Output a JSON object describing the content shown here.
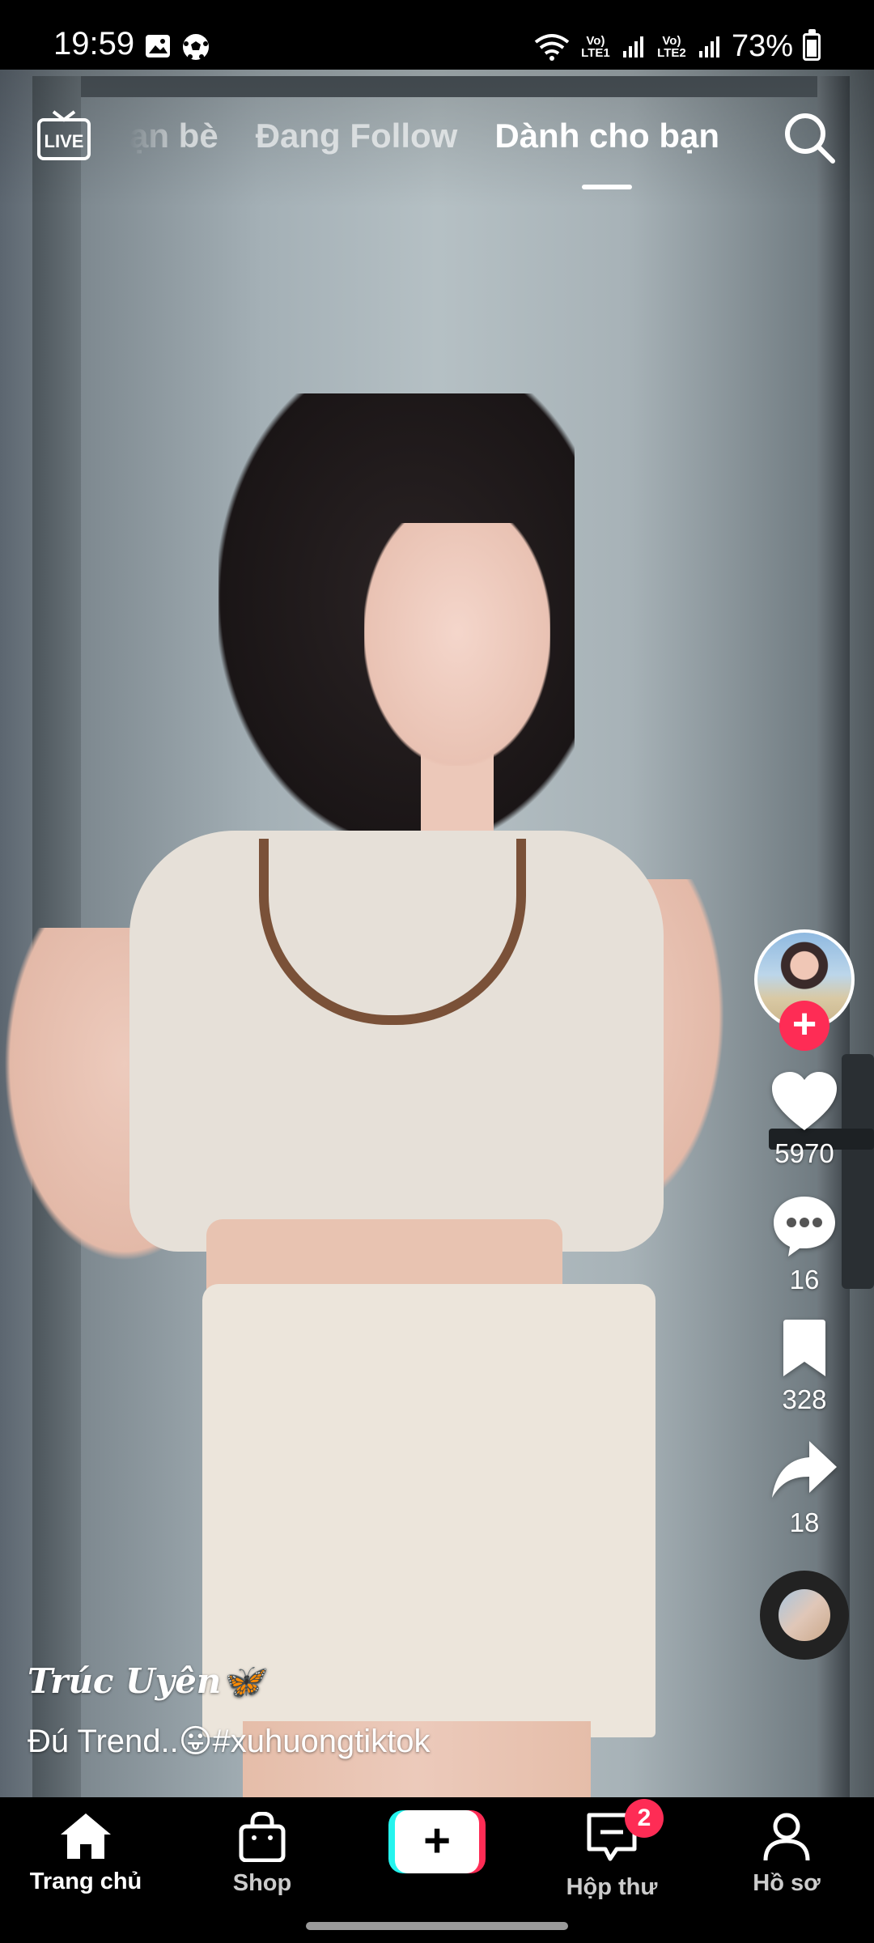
{
  "status_bar": {
    "time": "19:59",
    "lte1": "Vo) LTE1",
    "lte2": "Vo) LTE2",
    "battery": "73%",
    "battery_level": 0.73
  },
  "top_nav": {
    "live_label": "LIVE",
    "tabs": [
      {
        "label": "ạn bè"
      },
      {
        "label": "Đang Follow"
      },
      {
        "label": "Dành cho bạn"
      }
    ],
    "active_tab": "Dành cho bạn"
  },
  "actions": {
    "likes": "5970",
    "comments": "16",
    "bookmarks": "328",
    "shares": "18",
    "follow_symbol": "+"
  },
  "caption": {
    "username": "Trúc Uyên🦋",
    "text": "Đú Trend..😛#xuhuongtiktok"
  },
  "bottom_nav": {
    "home": "Trang chủ",
    "shop": "Shop",
    "create_symbol": "+",
    "inbox": "Hộp thư",
    "inbox_badge": "2",
    "profile": "Hồ sơ"
  },
  "colors": {
    "accent_red": "#fe2c55",
    "accent_cyan": "#25f4ee"
  }
}
